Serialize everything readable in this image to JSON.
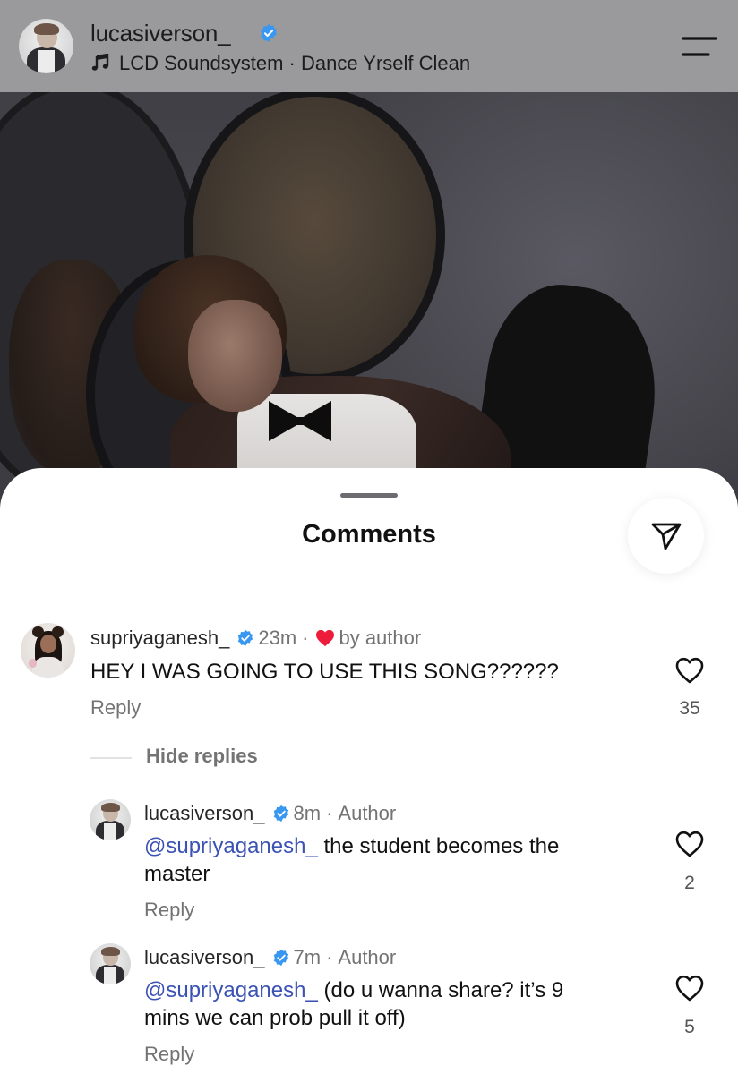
{
  "header": {
    "username": "lucasiverson_",
    "verified": true,
    "audio": "LCD Soundsystem · Dance Yrself Clean",
    "icons": {
      "music": "music-note-icon",
      "menu": "menu-icon",
      "verified": "verified-badge-icon"
    }
  },
  "sheet": {
    "title": "Comments",
    "share_icon": "send-icon",
    "hide_replies_label": "Hide replies"
  },
  "comments": [
    {
      "username": "supriyaganesh_",
      "verified": true,
      "time": "23m",
      "liked_by_author": "by author",
      "text": "HEY I WAS GOING TO USE THIS SONG??????",
      "reply_label": "Reply",
      "likes": "35"
    }
  ],
  "replies": [
    {
      "username": "lucasiverson_",
      "verified": true,
      "time": "8m",
      "tag": "Author",
      "mention": "@supriyaganesh_",
      "text_line1": " the student becomes the",
      "text_line2": "master",
      "reply_label": "Reply",
      "likes": "2"
    },
    {
      "username": "lucasiverson_",
      "verified": true,
      "time": "7m",
      "tag": "Author",
      "mention": "@supriyaganesh_",
      "text_line1": " (do u wanna share? it’s 9",
      "text_line2": "mins we can prob pull it off)",
      "reply_label": "Reply",
      "likes": "5"
    }
  ],
  "colors": {
    "verified_blue": "#3897f0",
    "heart_red": "#ed1c3a",
    "mention_blue": "#3a52b4",
    "header_bg": "#9a9a9c"
  }
}
